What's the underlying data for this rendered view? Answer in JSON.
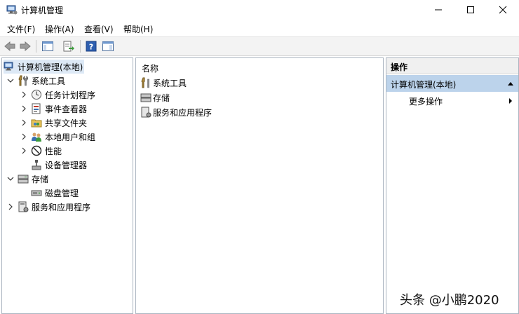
{
  "window": {
    "title": "计算机管理"
  },
  "menu": [
    "文件(F)",
    "操作(A)",
    "查看(V)",
    "帮助(H)"
  ],
  "tree": {
    "root": "计算机管理(本地)",
    "system_tools": "系统工具",
    "task_scheduler": "任务计划程序",
    "event_viewer": "事件查看器",
    "shared_folders": "共享文件夹",
    "local_users_groups": "本地用户和组",
    "performance": "性能",
    "device_manager": "设备管理器",
    "storage": "存储",
    "disk_management": "磁盘管理",
    "services_apps": "服务和应用程序"
  },
  "middle": {
    "column_name": "名称",
    "items": [
      "系统工具",
      "存储",
      "服务和应用程序"
    ]
  },
  "actions": {
    "title": "操作",
    "section": "计算机管理(本地)",
    "more": "更多操作"
  },
  "watermark": "头条 @小鹏2020"
}
